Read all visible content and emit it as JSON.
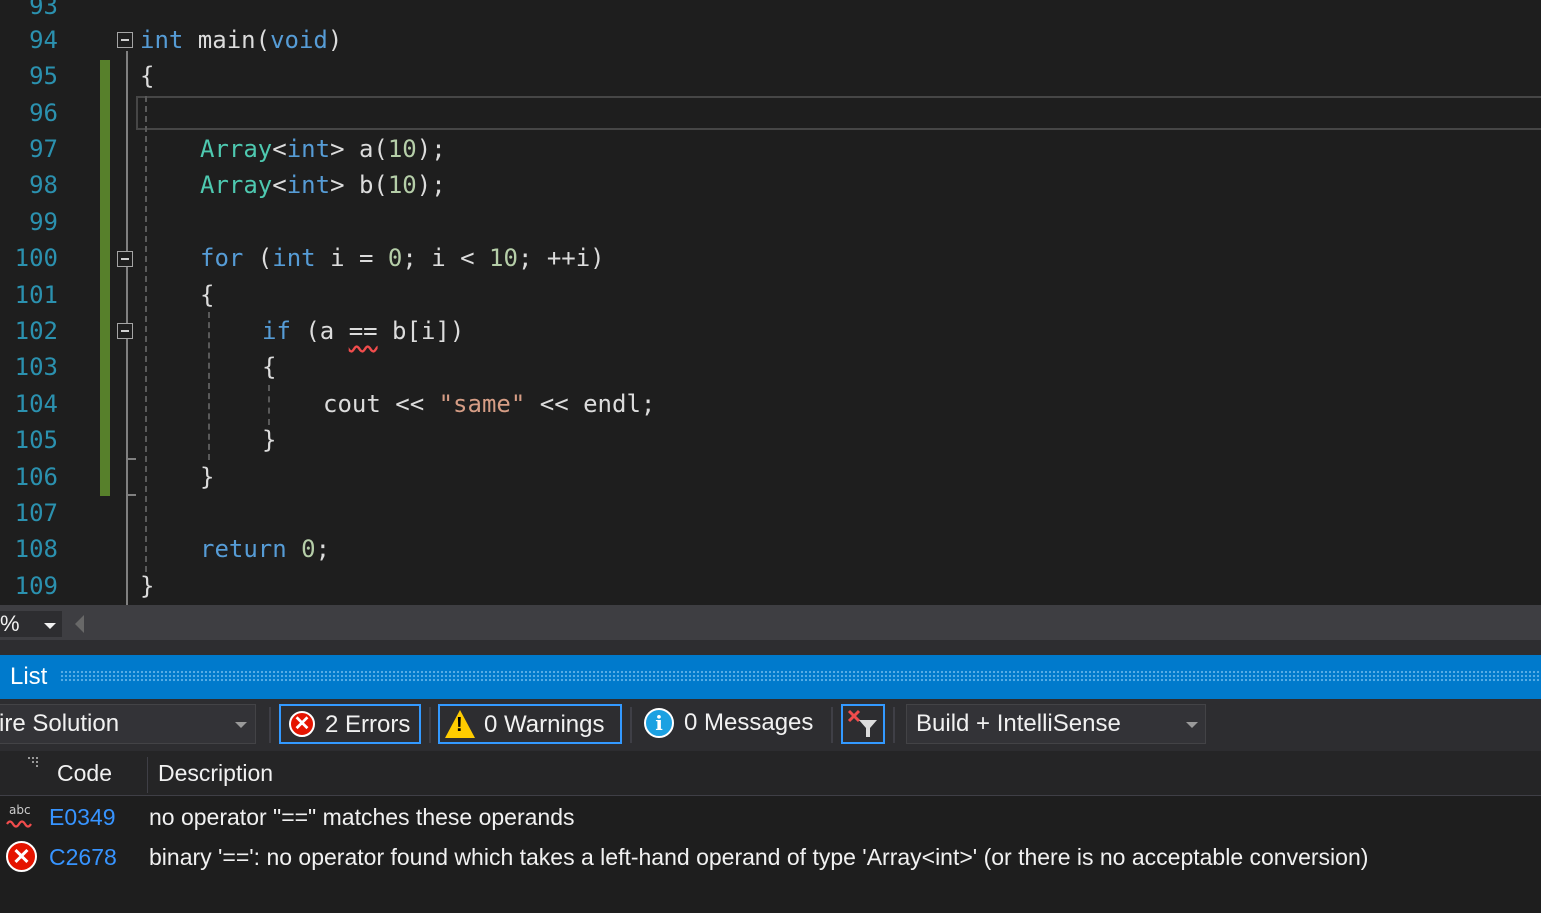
{
  "editor": {
    "line_numbers": [
      "93",
      "94",
      "95",
      "96",
      "97",
      "98",
      "99",
      "100",
      "101",
      "102",
      "103",
      "104",
      "105",
      "106",
      "107",
      "108",
      "109"
    ],
    "lines": {
      "l94_kw": "int",
      "l94_rest": " main(",
      "l94_void": "void",
      "l94_close": ")",
      "l95": "{",
      "l97_type": "Array",
      "l97_lt": "<",
      "l97_kw": "int",
      "l97_rest": "> a(",
      "l97_num": "10",
      "l97_end": ");",
      "l98_type": "Array",
      "l98_lt": "<",
      "l98_kw": "int",
      "l98_rest": "> b(",
      "l98_num": "10",
      "l98_end": ");",
      "l100_for": "for",
      "l100_a": " (",
      "l100_int": "int",
      "l100_b": " i = ",
      "l100_zero": "0",
      "l100_c": "; i < ",
      "l100_ten": "10",
      "l100_d": "; ++i)",
      "l101": "{",
      "l102_if": "if",
      "l102_a": " (a ",
      "l102_eq": "==",
      "l102_b": " b[i])",
      "l103": "{",
      "l104_a": "cout << ",
      "l104_str": "\"same\"",
      "l104_b": " << endl;",
      "l105": "}",
      "l106": "}",
      "l108_ret": "return",
      "l108_sp": " ",
      "l108_zero": "0",
      "l108_end": ";",
      "l109": "}"
    }
  },
  "zoom": {
    "label": "%"
  },
  "error_list": {
    "title": "List",
    "scope": "ire Solution",
    "errors_label": "2 Errors",
    "warnings_label": "0 Warnings",
    "messages_label": "0 Messages",
    "source_filter": "Build + IntelliSense",
    "columns": {
      "code": "Code",
      "description": "Description"
    },
    "rows": [
      {
        "icon": "intellisense-error-icon",
        "code": "E0349",
        "description": "no operator \"==\" matches these operands"
      },
      {
        "icon": "error-icon",
        "code": "C2678",
        "description": "binary '==': no operator found which takes a left-hand operand of type 'Array<int>' (or there is no acceptable conversion)"
      }
    ]
  },
  "colors": {
    "keyword": "#569cd6",
    "type": "#4ec9b0",
    "number": "#b5cea8",
    "string": "#d69d85",
    "line_number": "#2b91af",
    "accent": "#007acc",
    "error_red": "#e51400",
    "change_bar": "#57802b"
  }
}
